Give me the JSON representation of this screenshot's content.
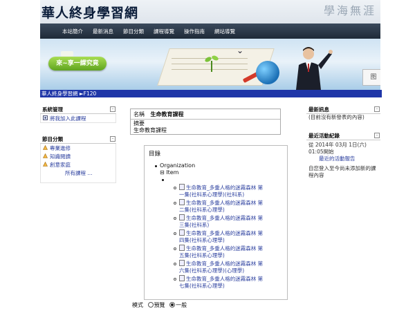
{
  "site": {
    "title": "華人終身學習網",
    "calligraphy": "學海無涯"
  },
  "nav": [
    "本站簡介",
    "最新消息",
    "節目分類",
    "課程導覽",
    "操作指南",
    "網站導覽"
  ],
  "banner": {
    "cta_label": "來~享一課究竟",
    "seal_text": "图"
  },
  "breadcrumb": "華人終身學習網 ►F120",
  "left": {
    "system": {
      "title": "系統管理",
      "items": [
        "將我加入此課程"
      ]
    },
    "categories": {
      "title": "節目分類",
      "items": [
        "專業進修",
        "知識閱讀",
        "創意家庭"
      ],
      "all_link": "所有課程 ..."
    }
  },
  "right": {
    "news": {
      "title": "最新訊息",
      "body": "(目前沒有新發表的內容)"
    },
    "activity": {
      "title": "最近活動紀錄",
      "since": "從 2014年 03月 1日(六) 01:05開始",
      "link": "最近的活動報告",
      "note": "自您登入至今尚未添加新的課程內容"
    }
  },
  "course": {
    "name_label": "名稱",
    "name": "生命教育課程",
    "summary_label": "摘要",
    "summary": "生命教育課程"
  },
  "toc": {
    "title": "目錄",
    "organization": "Organization",
    "item_label": "Item",
    "items": [
      [
        "生命教育_多重人格的迷霧森林 第",
        "一集(社科系心理學)(社科系)"
      ],
      [
        "生命教育_多重人格的迷霧森林 第",
        "二集(社科系心理學)"
      ],
      [
        "生命教育_多重人格的迷霧森林 第",
        "三集(社科系)"
      ],
      [
        "生命教育_多重人格的迷霧森林 第",
        "四集(社科系心理學)"
      ],
      [
        "生命教育_多重人格的迷霧森林 第",
        "五集(社科系心理學)"
      ],
      [
        "生命教育_多重人格的迷霧森林 第",
        "六集(社科系心理學)(心理學)"
      ],
      [
        "生命教育_多重人格的迷霧森林 第",
        "七集(社科系心理學)"
      ]
    ]
  },
  "mode": {
    "label": "模式",
    "options": [
      "預覽",
      "一般"
    ],
    "selected": "一般"
  },
  "colors": {
    "nav_bg": "#1e2a38",
    "breadcrumb_bar": "#1f36a8",
    "link": "#2a3e9e",
    "cta_green": "#6fb52a"
  }
}
